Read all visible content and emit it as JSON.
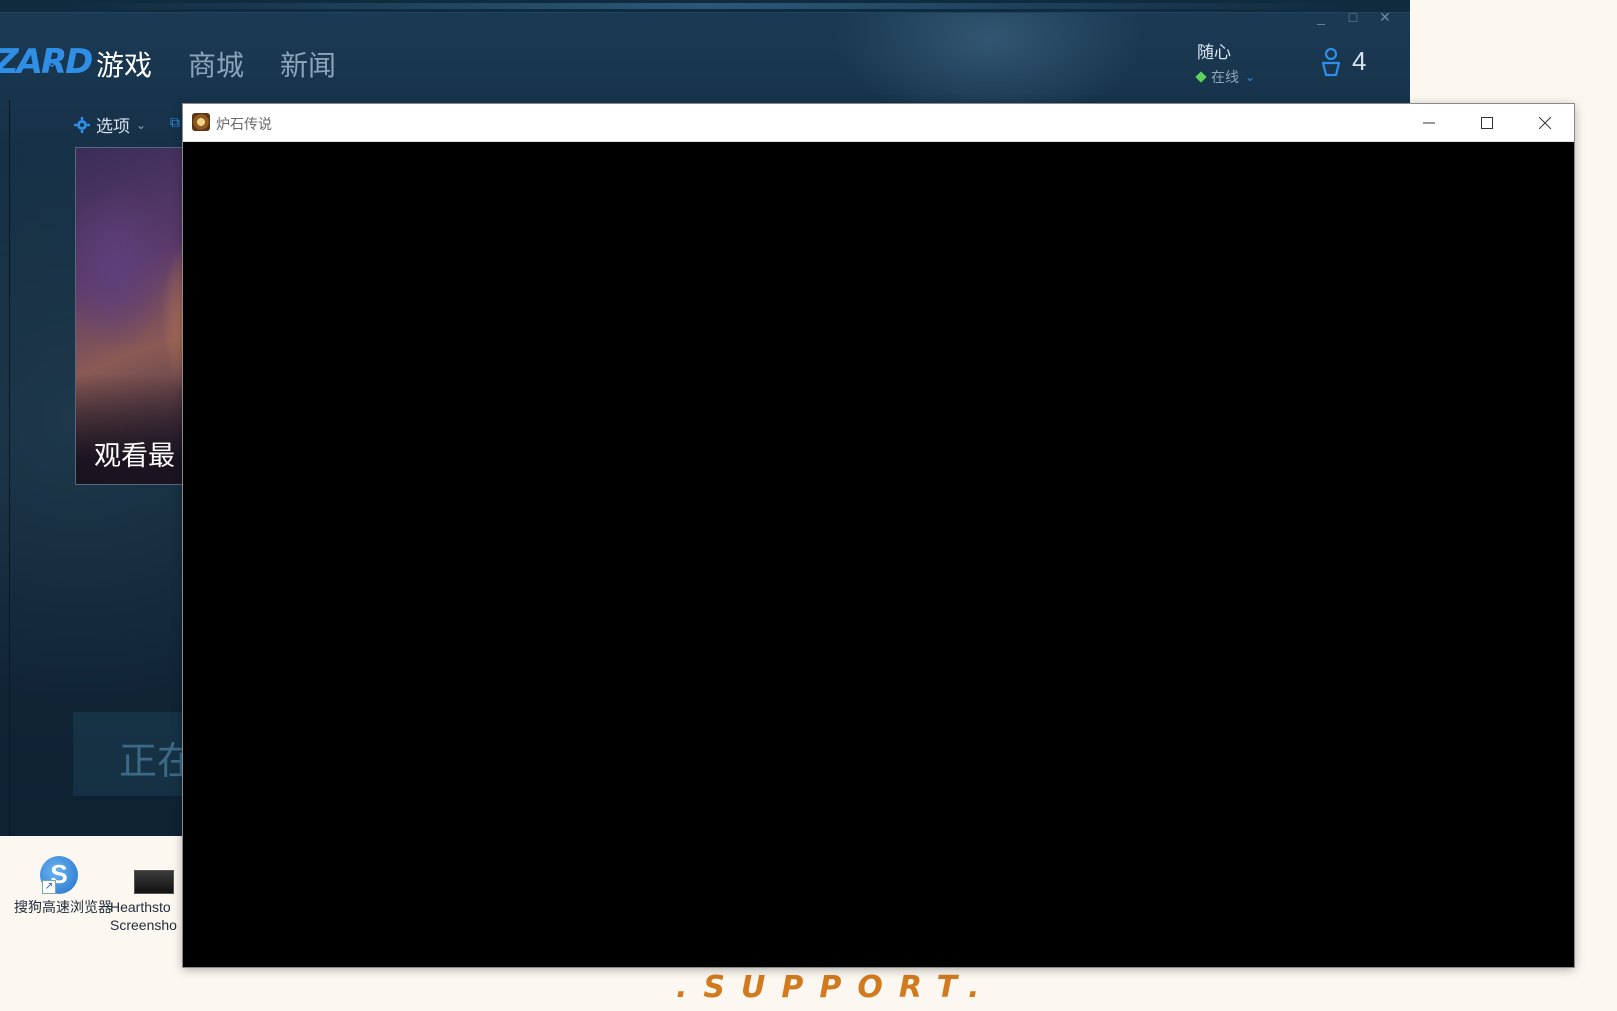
{
  "launcher": {
    "logo_text": "ZARD",
    "nav": [
      "游戏",
      "商城",
      "新闻"
    ],
    "user_name": "随心",
    "user_status": "在线",
    "friends_count": "4",
    "toolbar_options": "选项",
    "promo_text": "观看最",
    "playing_text": "正在"
  },
  "desktop": {
    "icons": [
      {
        "label": "搜狗高速浏览器",
        "icon": "sogou-browser-icon"
      },
      {
        "label": "Hearthsto Screensho",
        "icon": "screenshot-thumbnail-icon"
      }
    ]
  },
  "game_window": {
    "title": "炉石传说",
    "icon": "hearthstone-icon"
  },
  "support_text": ".SUPPORT."
}
